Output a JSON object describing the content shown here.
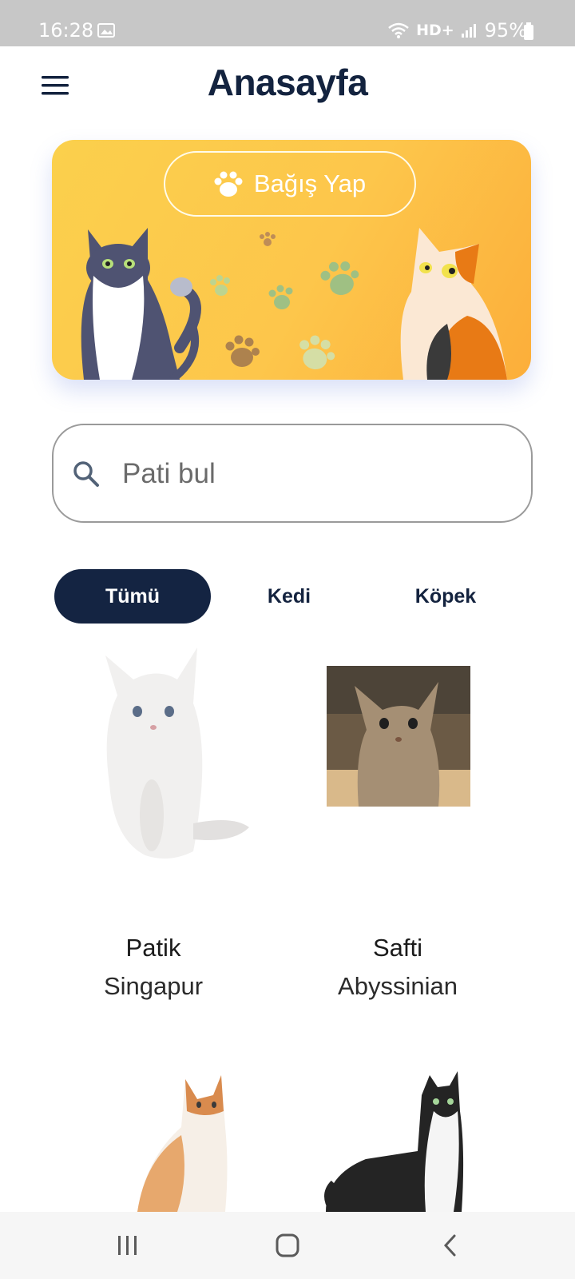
{
  "status_bar": {
    "time": "16:28",
    "network_label": "HD+",
    "battery": "95%"
  },
  "header": {
    "title": "Anasayfa",
    "menu_icon": "hamburger-menu-icon"
  },
  "banner": {
    "donate_label": "Bağış Yap",
    "donate_icon": "paw-icon",
    "background_color": "#fdc64b"
  },
  "search": {
    "placeholder": "Pati bul",
    "icon": "search-icon"
  },
  "tabs": [
    {
      "label": "Tümü",
      "active": true
    },
    {
      "label": "Kedi",
      "active": false
    },
    {
      "label": "Köpek",
      "active": false
    }
  ],
  "pets": [
    {
      "name": "Patik",
      "breed": "Singapur",
      "image": "white-fluffy-cat"
    },
    {
      "name": "Safti",
      "breed": "Abyssinian",
      "image": "tabby-kitten"
    },
    {
      "name": "",
      "breed": "",
      "image": "orange-white-cat"
    },
    {
      "name": "",
      "breed": "",
      "image": "black-white-cat"
    }
  ],
  "colors": {
    "primary": "#142442",
    "accent": "#fdc64b",
    "text": "#14233f"
  },
  "nav_bar": {
    "recents_icon": "recents-icon",
    "home_icon": "home-icon",
    "back_icon": "back-icon"
  }
}
